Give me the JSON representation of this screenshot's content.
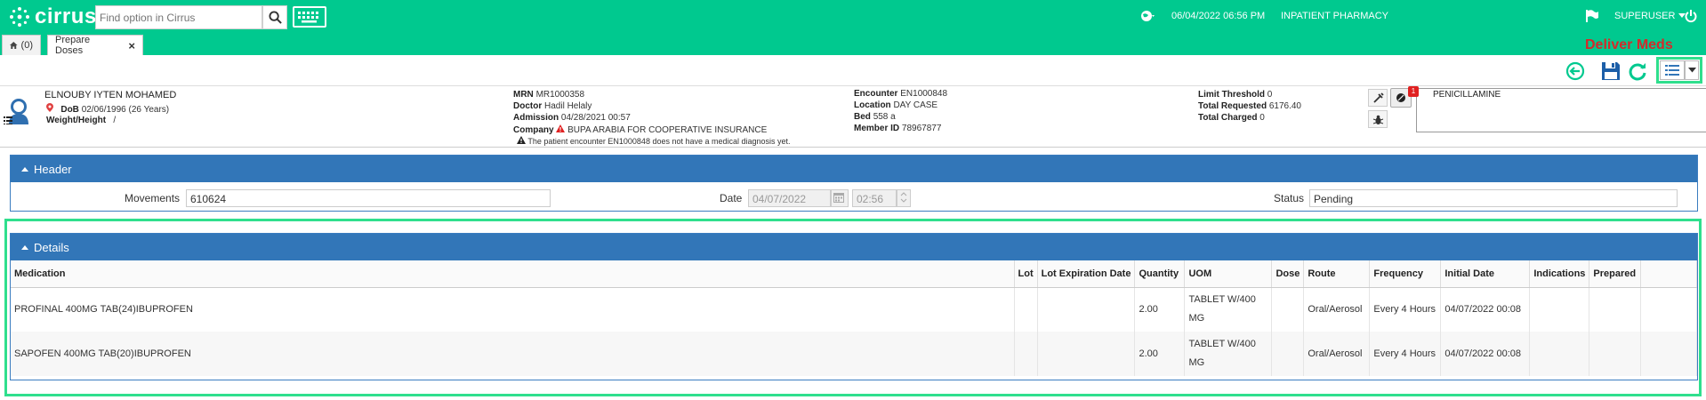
{
  "app": {
    "name": "cirrus"
  },
  "topbar": {
    "search_placeholder": "Find option in Cirrus",
    "datetime": "06/04/2022 06:56 PM",
    "department": "INPATIENT PHARMACY",
    "user": "SUPERUSER",
    "accent": "#00c98f"
  },
  "tabs": [
    {
      "label": "(0)"
    },
    {
      "label": "Prepare Doses"
    }
  ],
  "annotation": {
    "deliver_label": "Deliver Meds",
    "color": "#d42a2a",
    "frame_color": "#2fdf8d"
  },
  "patient": {
    "name": "ELNOUBY IYTEN MOHAMED",
    "dob_label": "DoB",
    "dob": "02/06/1996 (26 Years)",
    "weight_label": "Weight/Height",
    "weight": "/",
    "mrn_label": "MRN",
    "mrn": "MR1000358",
    "doctor_label": "Doctor",
    "doctor": "Hadil Helaly",
    "admission_label": "Admission",
    "admission": "04/28/2021 00:57",
    "company_label": "Company",
    "company": "BUPA ARABIA FOR COOPERATIVE INSURANCE",
    "diagnosis_warning": "The patient encounter EN1000848 does not have a medical diagnosis yet.",
    "encounter_label": "Encounter",
    "encounter": "EN1000848",
    "location_label": "Location",
    "location": "DAY CASE",
    "bed_label": "Bed",
    "bed": "558 a",
    "member_label": "Member ID",
    "member": "78967877",
    "limit_label": "Limit Threshold",
    "limit": "0",
    "requested_label": "Total Requested",
    "requested": "6176.40",
    "charged_label": "Total Charged",
    "charged": "0",
    "allergy_count": "1",
    "allergy": "PENICILLAMINE"
  },
  "header_panel": {
    "title": "Header",
    "movements_label": "Movements",
    "movements": "610624",
    "date_label": "Date",
    "date": "04/07/2022",
    "time": "02:56",
    "status_label": "Status",
    "status": "Pending"
  },
  "details_panel": {
    "title": "Details",
    "columns": [
      "Medication",
      "Lot",
      "Lot Expiration Date",
      "Quantity",
      "UOM",
      "Dose",
      "Route",
      "Frequency",
      "Initial Date",
      "Indications",
      "Prepared"
    ],
    "rows": [
      {
        "medication": "PROFINAL 400MG TAB(24)IBUPROFEN",
        "lot": "",
        "lot_exp": "",
        "quantity": "2.00",
        "uom": "TABLET W/400 MG",
        "dose": "",
        "route": "Oral/Aerosol",
        "frequency": "Every 4 Hours",
        "initial_date": "04/07/2022 00:08",
        "indications": "",
        "prepared": ""
      },
      {
        "medication": "SAPOFEN 400MG TAB(20)IBUPROFEN",
        "lot": "",
        "lot_exp": "",
        "quantity": "2.00",
        "uom": "TABLET W/400 MG",
        "dose": "",
        "route": "Oral/Aerosol",
        "frequency": "Every 4 Hours",
        "initial_date": "04/07/2022 00:08",
        "indications": "",
        "prepared": ""
      }
    ]
  }
}
